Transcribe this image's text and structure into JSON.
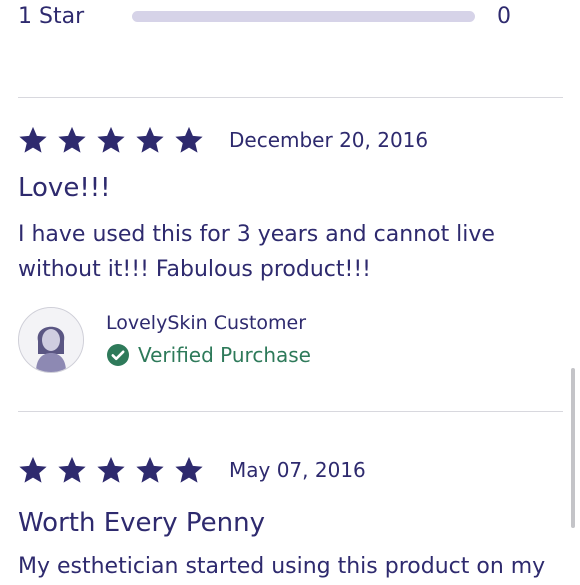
{
  "rating_breakdown": {
    "label": "1 Star",
    "count": "0",
    "fill_fraction": 0
  },
  "reviews": [
    {
      "star_count": 5,
      "date": "December 20, 2016",
      "title": "Love!!!",
      "body": "I have used this for 3 years and cannot live without it!!! Fabulous product!!!",
      "reviewer_name": "LovelySkin Customer",
      "verified_label": "Verified Purchase"
    },
    {
      "star_count": 5,
      "date": "May 07, 2016",
      "title": "Worth Every Penny",
      "body": "My esthetician started using this product on my"
    }
  ],
  "colors": {
    "text": "#2e2a6e",
    "star": "#2e2a6e",
    "verified": "#2e7a5a",
    "bar_track": "#d6d3e8"
  },
  "icons": {
    "star": "star-icon",
    "avatar": "user-avatar-icon",
    "verified": "check-circle-icon"
  }
}
